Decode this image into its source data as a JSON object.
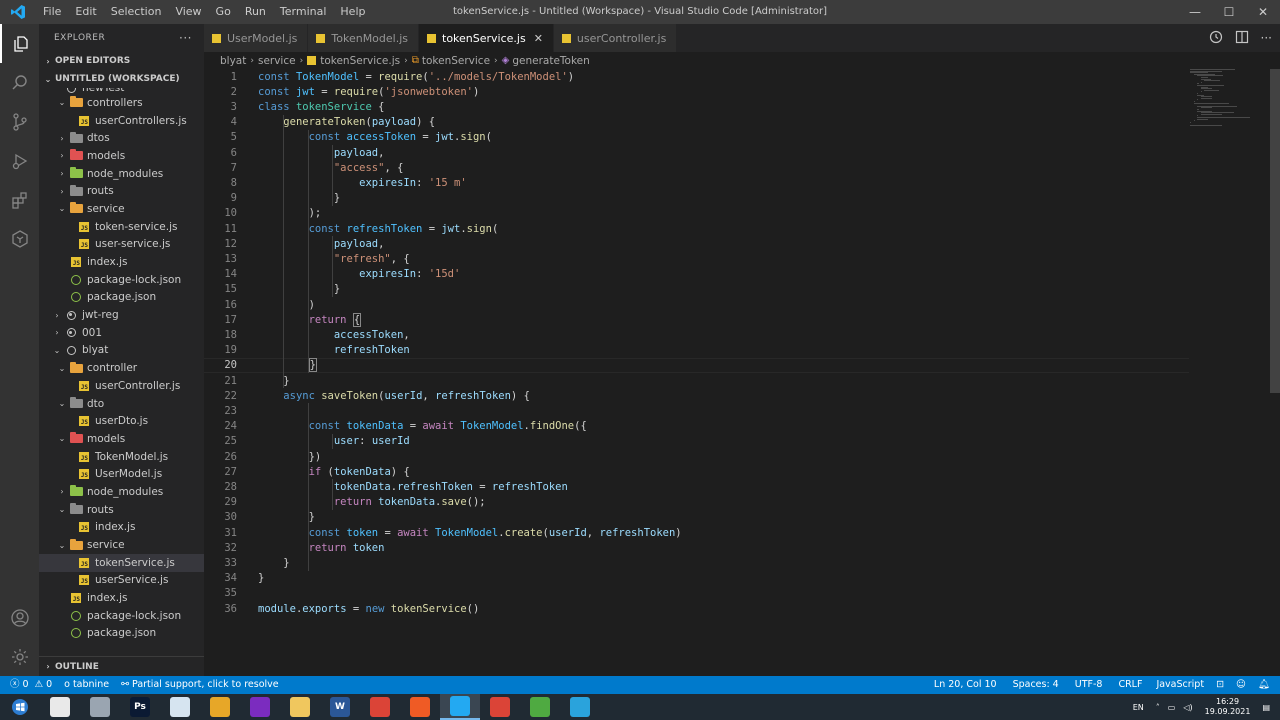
{
  "window": {
    "title": "tokenService.js - Untitled (Workspace) - Visual Studio Code [Administrator]",
    "menu": [
      "File",
      "Edit",
      "Selection",
      "View",
      "Go",
      "Run",
      "Terminal",
      "Help"
    ],
    "controls": {
      "minimize": "—",
      "maximize": "☐",
      "close": "✕"
    }
  },
  "sidebar": {
    "title": "EXPLORER",
    "more": "···",
    "open_editors": "OPEN EDITORS",
    "workspace": "UNTITLED (WORKSPACE)",
    "outline": "OUTLINE",
    "tree": [
      {
        "label": "newTest",
        "type": "circle",
        "depth": 0,
        "chev": "",
        "partial": true
      },
      {
        "label": "controllers",
        "type": "folder",
        "color": "#e8a33d",
        "depth": 1,
        "chev": "⌄"
      },
      {
        "label": "userControllers.js",
        "type": "js",
        "depth": 2,
        "chev": ""
      },
      {
        "label": "dtos",
        "type": "folder",
        "color": "#8c8c8c",
        "depth": 1,
        "chev": "›"
      },
      {
        "label": "models",
        "type": "folder",
        "color": "#e05252",
        "depth": 1,
        "chev": "›"
      },
      {
        "label": "node_modules",
        "type": "folder",
        "color": "#8dc149",
        "depth": 1,
        "chev": "›"
      },
      {
        "label": "routs",
        "type": "folder",
        "color": "#8c8c8c",
        "depth": 1,
        "chev": "›"
      },
      {
        "label": "service",
        "type": "folder",
        "color": "#e8a33d",
        "depth": 1,
        "chev": "⌄"
      },
      {
        "label": "token-service.js",
        "type": "js",
        "depth": 2,
        "chev": ""
      },
      {
        "label": "user-service.js",
        "type": "js",
        "depth": 2,
        "chev": ""
      },
      {
        "label": "index.js",
        "type": "js",
        "depth": 1,
        "chev": ""
      },
      {
        "label": "package-lock.json",
        "type": "json",
        "depth": 1,
        "chev": ""
      },
      {
        "label": "package.json",
        "type": "json",
        "depth": 1,
        "chev": ""
      },
      {
        "label": "jwt-reg",
        "type": "circle-filled",
        "depth": 0,
        "chev": "›"
      },
      {
        "label": "001",
        "type": "circle-filled",
        "depth": 0,
        "chev": "›"
      },
      {
        "label": "blyat",
        "type": "circle",
        "depth": 0,
        "chev": "⌄"
      },
      {
        "label": "controller",
        "type": "folder",
        "color": "#e8a33d",
        "depth": 1,
        "chev": "⌄"
      },
      {
        "label": "userController.js",
        "type": "js",
        "depth": 2,
        "chev": ""
      },
      {
        "label": "dto",
        "type": "folder",
        "color": "#8c8c8c",
        "depth": 1,
        "chev": "⌄"
      },
      {
        "label": "userDto.js",
        "type": "js",
        "depth": 2,
        "chev": ""
      },
      {
        "label": "models",
        "type": "folder",
        "color": "#e05252",
        "depth": 1,
        "chev": "⌄"
      },
      {
        "label": "TokenModel.js",
        "type": "js",
        "depth": 2,
        "chev": ""
      },
      {
        "label": "UserModel.js",
        "type": "js",
        "depth": 2,
        "chev": ""
      },
      {
        "label": "node_modules",
        "type": "folder",
        "color": "#8dc149",
        "depth": 1,
        "chev": "›"
      },
      {
        "label": "routs",
        "type": "folder",
        "color": "#8c8c8c",
        "depth": 1,
        "chev": "⌄"
      },
      {
        "label": "index.js",
        "type": "js",
        "depth": 2,
        "chev": ""
      },
      {
        "label": "service",
        "type": "folder",
        "color": "#e8a33d",
        "depth": 1,
        "chev": "⌄"
      },
      {
        "label": "tokenService.js",
        "type": "js",
        "depth": 2,
        "chev": "",
        "selected": true
      },
      {
        "label": "userService.js",
        "type": "js",
        "depth": 2,
        "chev": ""
      },
      {
        "label": "index.js",
        "type": "js",
        "depth": 1,
        "chev": ""
      },
      {
        "label": "package-lock.json",
        "type": "json",
        "depth": 1,
        "chev": ""
      },
      {
        "label": "package.json",
        "type": "json",
        "depth": 1,
        "chev": ""
      }
    ]
  },
  "tabs": [
    {
      "label": "UserModel.js",
      "active": false
    },
    {
      "label": "TokenModel.js",
      "active": false
    },
    {
      "label": "tokenService.js",
      "active": true,
      "close": "✕"
    },
    {
      "label": "userController.js",
      "active": false
    }
  ],
  "breadcrumb": [
    "blyat",
    "service",
    "tokenService.js",
    "tokenService",
    "generateToken"
  ],
  "editor": {
    "current_line": 20,
    "lines": [
      [
        [
          "k",
          "const "
        ],
        [
          "cl",
          "TokenModel"
        ],
        [
          "p",
          " = "
        ],
        [
          "f",
          "require"
        ],
        [
          "p",
          "("
        ],
        [
          "s",
          "'../models/TokenModel'"
        ],
        [
          "p",
          ")"
        ]
      ],
      [
        [
          "k",
          "const "
        ],
        [
          "cl",
          "jwt"
        ],
        [
          "p",
          " = "
        ],
        [
          "f",
          "require"
        ],
        [
          "p",
          "("
        ],
        [
          "s",
          "'jsonwebtoken'"
        ],
        [
          "p",
          ")"
        ]
      ],
      [
        [
          "k",
          "class "
        ],
        [
          "t",
          "tokenService"
        ],
        [
          "p",
          " {"
        ]
      ],
      [
        [
          "p",
          "    "
        ],
        [
          "f",
          "generateToken"
        ],
        [
          "p",
          "("
        ],
        [
          "v",
          "payload"
        ],
        [
          "p",
          ") {"
        ]
      ],
      [
        [
          "p",
          "        "
        ],
        [
          "k",
          "const "
        ],
        [
          "cl",
          "accessToken"
        ],
        [
          "p",
          " = "
        ],
        [
          "v",
          "jwt"
        ],
        [
          "p",
          "."
        ],
        [
          "f",
          "sign"
        ],
        [
          "p",
          "("
        ]
      ],
      [
        [
          "p",
          "            "
        ],
        [
          "v",
          "payload"
        ],
        [
          "p",
          ","
        ]
      ],
      [
        [
          "p",
          "            "
        ],
        [
          "s",
          "\"access\""
        ],
        [
          "p",
          ", {"
        ]
      ],
      [
        [
          "p",
          "                "
        ],
        [
          "v",
          "expiresIn"
        ],
        [
          "p",
          ": "
        ],
        [
          "s",
          "'15 m'"
        ]
      ],
      [
        [
          "p",
          "            }"
        ]
      ],
      [
        [
          "p",
          "        );"
        ]
      ],
      [
        [
          "p",
          "        "
        ],
        [
          "k",
          "const "
        ],
        [
          "cl",
          "refreshToken"
        ],
        [
          "p",
          " = "
        ],
        [
          "v",
          "jwt"
        ],
        [
          "p",
          "."
        ],
        [
          "f",
          "sign"
        ],
        [
          "p",
          "("
        ]
      ],
      [
        [
          "p",
          "            "
        ],
        [
          "v",
          "payload"
        ],
        [
          "p",
          ","
        ]
      ],
      [
        [
          "p",
          "            "
        ],
        [
          "s",
          "\"refresh\""
        ],
        [
          "p",
          ", {"
        ]
      ],
      [
        [
          "p",
          "                "
        ],
        [
          "v",
          "expiresIn"
        ],
        [
          "p",
          ": "
        ],
        [
          "s",
          "'15d'"
        ]
      ],
      [
        [
          "p",
          "            }"
        ]
      ],
      [
        [
          "p",
          "        )"
        ]
      ],
      [
        [
          "p",
          "        "
        ],
        [
          "c",
          "return"
        ],
        [
          "p",
          " "
        ],
        [
          "br",
          "{"
        ]
      ],
      [
        [
          "p",
          "            "
        ],
        [
          "v",
          "accessToken"
        ],
        [
          "p",
          ","
        ]
      ],
      [
        [
          "p",
          "            "
        ],
        [
          "v",
          "refreshToken"
        ]
      ],
      [
        [
          "p",
          "        "
        ],
        [
          "br",
          "}"
        ]
      ],
      [
        [
          "p",
          "    }"
        ]
      ],
      [
        [
          "p",
          "    "
        ],
        [
          "k",
          "async "
        ],
        [
          "f",
          "saveToken"
        ],
        [
          "p",
          "("
        ],
        [
          "v",
          "userId"
        ],
        [
          "p",
          ", "
        ],
        [
          "v",
          "refreshToken"
        ],
        [
          "p",
          ") {"
        ]
      ],
      [
        [
          "p",
          ""
        ]
      ],
      [
        [
          "p",
          "        "
        ],
        [
          "k",
          "const "
        ],
        [
          "cl",
          "tokenData"
        ],
        [
          "p",
          " = "
        ],
        [
          "c",
          "await"
        ],
        [
          "p",
          " "
        ],
        [
          "cl",
          "TokenModel"
        ],
        [
          "p",
          "."
        ],
        [
          "f",
          "findOne"
        ],
        [
          "p",
          "({"
        ]
      ],
      [
        [
          "p",
          "            "
        ],
        [
          "v",
          "user"
        ],
        [
          "p",
          ": "
        ],
        [
          "v",
          "userId"
        ]
      ],
      [
        [
          "p",
          "        })"
        ]
      ],
      [
        [
          "p",
          "        "
        ],
        [
          "c",
          "if"
        ],
        [
          "p",
          " ("
        ],
        [
          "v",
          "tokenData"
        ],
        [
          "p",
          ") {"
        ]
      ],
      [
        [
          "p",
          "            "
        ],
        [
          "v",
          "tokenData"
        ],
        [
          "p",
          "."
        ],
        [
          "v",
          "refreshToken"
        ],
        [
          "p",
          " = "
        ],
        [
          "v",
          "refreshToken"
        ]
      ],
      [
        [
          "p",
          "            "
        ],
        [
          "c",
          "return"
        ],
        [
          "p",
          " "
        ],
        [
          "v",
          "tokenData"
        ],
        [
          "p",
          "."
        ],
        [
          "f",
          "save"
        ],
        [
          "p",
          "();"
        ]
      ],
      [
        [
          "p",
          "        }"
        ]
      ],
      [
        [
          "p",
          "        "
        ],
        [
          "k",
          "const "
        ],
        [
          "cl",
          "token"
        ],
        [
          "p",
          " = "
        ],
        [
          "c",
          "await"
        ],
        [
          "p",
          " "
        ],
        [
          "cl",
          "TokenModel"
        ],
        [
          "p",
          "."
        ],
        [
          "f",
          "create"
        ],
        [
          "p",
          "("
        ],
        [
          "v",
          "userId"
        ],
        [
          "p",
          ", "
        ],
        [
          "v",
          "refreshToken"
        ],
        [
          "p",
          ")"
        ]
      ],
      [
        [
          "p",
          "        "
        ],
        [
          "c",
          "return"
        ],
        [
          "p",
          " "
        ],
        [
          "v",
          "token"
        ]
      ],
      [
        [
          "p",
          "    }"
        ]
      ],
      [
        [
          "p",
          "}"
        ]
      ],
      [
        [
          "p",
          ""
        ]
      ],
      [
        [
          "v",
          "module"
        ],
        [
          "p",
          "."
        ],
        [
          "v",
          "exports"
        ],
        [
          "p",
          " = "
        ],
        [
          "k",
          "new "
        ],
        [
          "f",
          "tokenService"
        ],
        [
          "p",
          "()"
        ]
      ]
    ]
  },
  "statusbar": {
    "errors": "0",
    "warnings": "0",
    "tabnine": "tabnine",
    "partial": "Partial support, click to resolve",
    "position": "Ln 20, Col 10",
    "spaces": "Spaces: 4",
    "encoding": "UTF-8",
    "eol": "CRLF",
    "language": "JavaScript"
  },
  "taskbar": {
    "apps": [
      {
        "name": "start-button",
        "glyph": "",
        "color": "#2d7dd2"
      },
      {
        "name": "task-app-edge",
        "glyph": "",
        "color": "#e9e9e9"
      },
      {
        "name": "task-app-window",
        "glyph": "",
        "color": "#9aa5b1"
      },
      {
        "name": "task-app-photoshop",
        "glyph": "Ps",
        "color": "#0b1a33"
      },
      {
        "name": "task-app-notepad",
        "glyph": "",
        "color": "#d6e4f0"
      },
      {
        "name": "task-app-media",
        "glyph": "",
        "color": "#e7a728"
      },
      {
        "name": "task-app-podcast",
        "glyph": "",
        "color": "#7b2cbf"
      },
      {
        "name": "task-app-explorer",
        "glyph": "",
        "color": "#f0c75e"
      },
      {
        "name": "task-app-word",
        "glyph": "W",
        "color": "#2b5797"
      },
      {
        "name": "task-app-chrome",
        "glyph": "",
        "color": "#db4437"
      },
      {
        "name": "task-app-postman",
        "glyph": "",
        "color": "#ef5b25"
      },
      {
        "name": "task-app-vscode",
        "glyph": "",
        "color": "#23a9f2",
        "active": true
      },
      {
        "name": "task-app-chrome-2",
        "glyph": "",
        "color": "#db4437"
      },
      {
        "name": "task-app-mongodb",
        "glyph": "",
        "color": "#4faa41"
      },
      {
        "name": "task-app-telegram",
        "glyph": "",
        "color": "#2aa3dc"
      }
    ],
    "lang": "EN",
    "time": "16:29",
    "date": "19.09.2021"
  }
}
